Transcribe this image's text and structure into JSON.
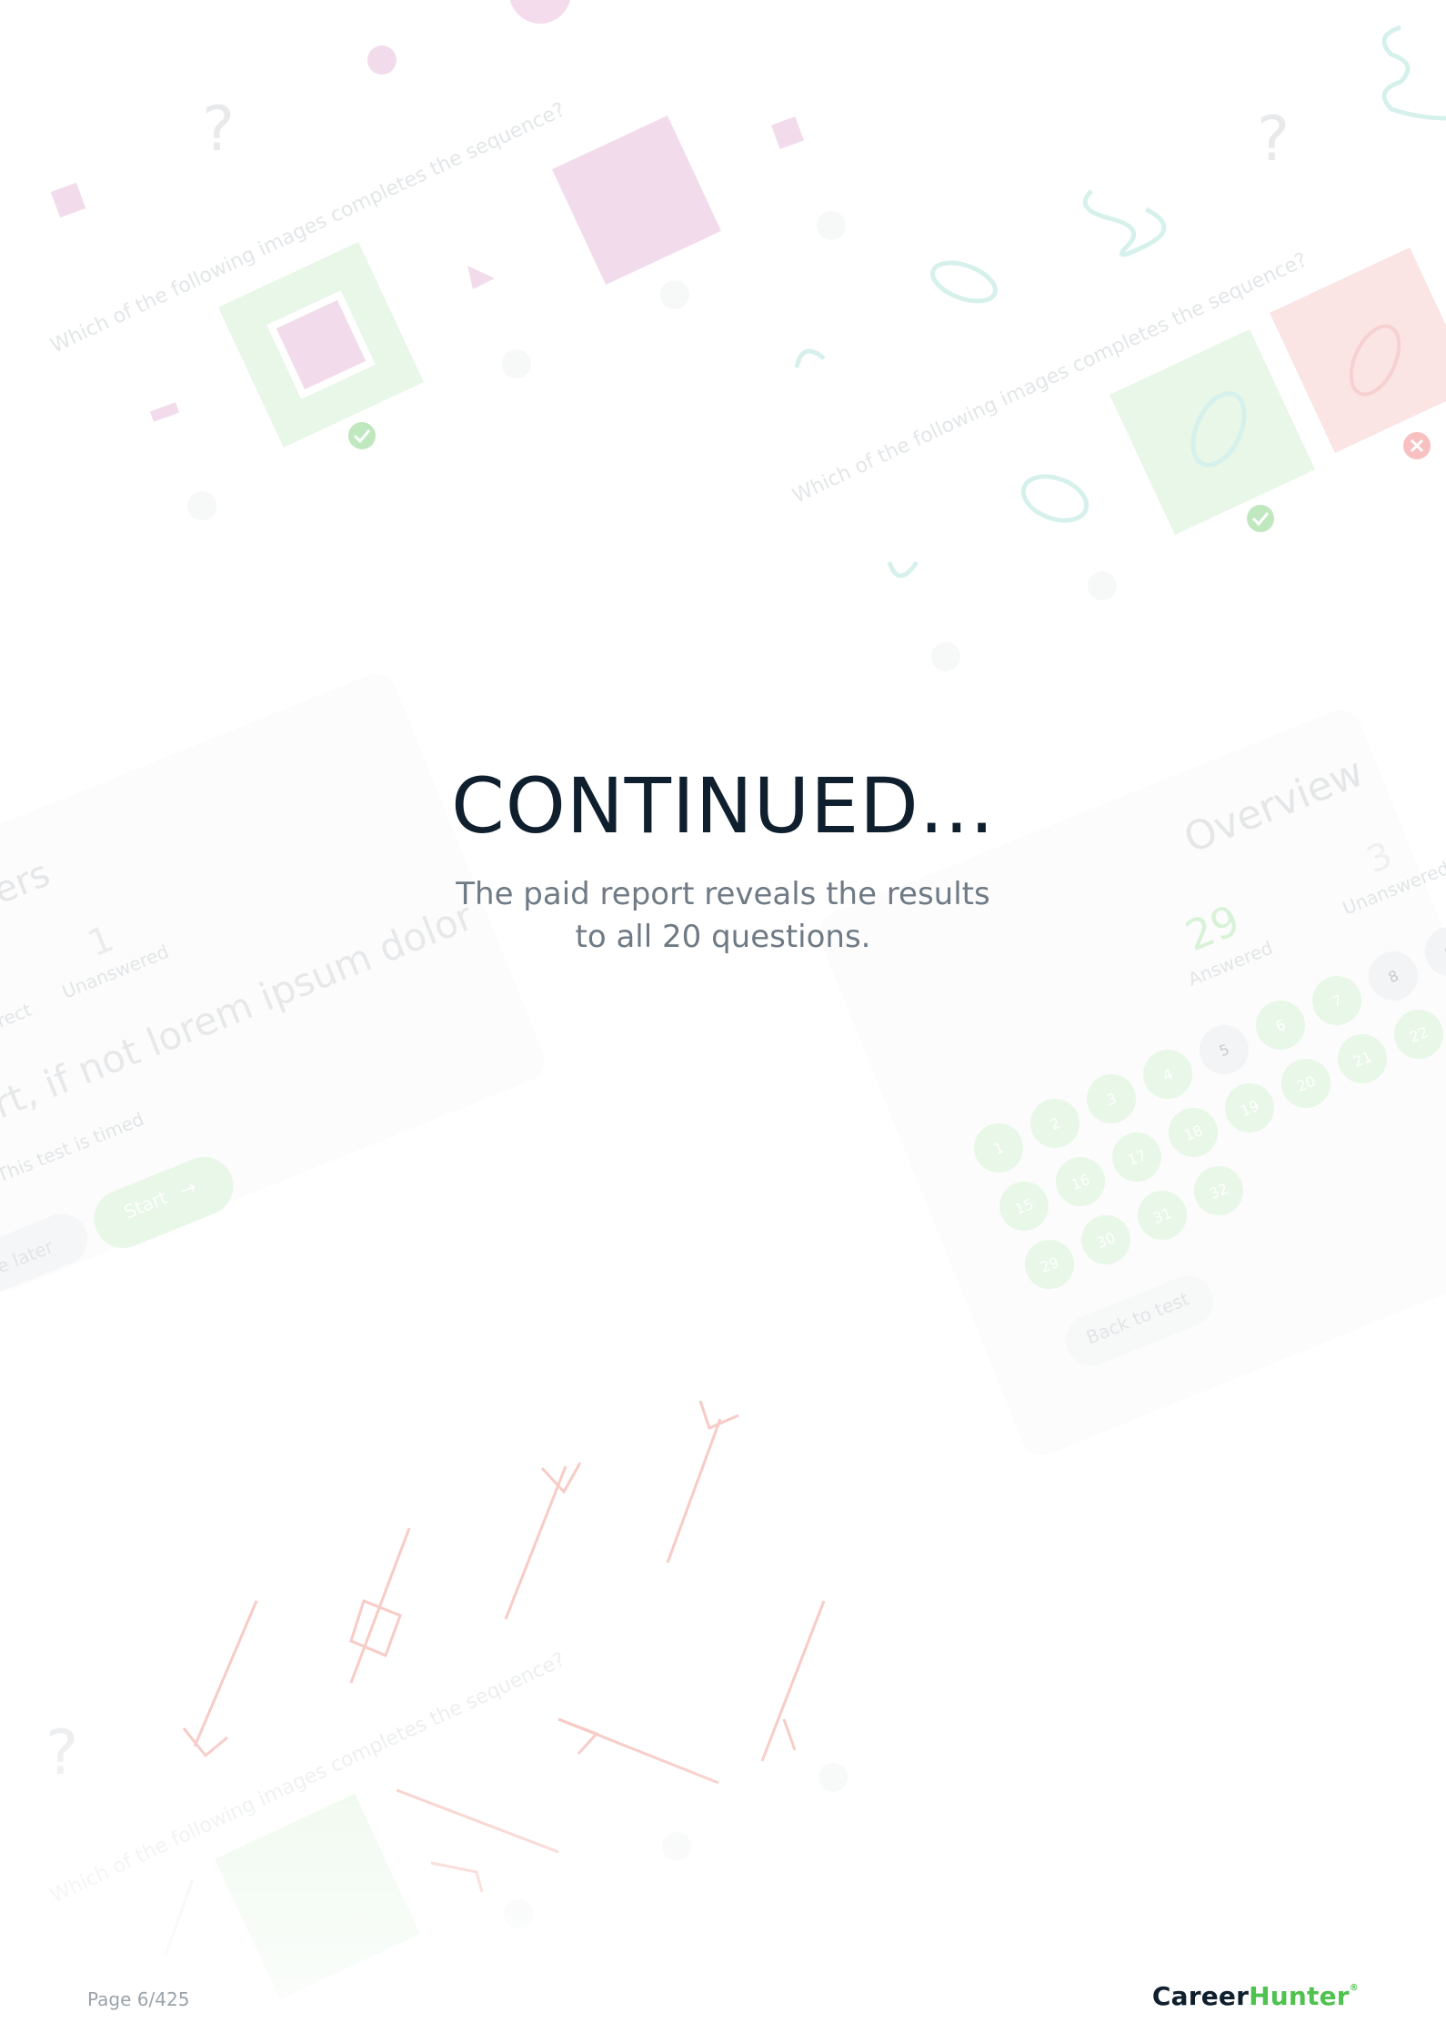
{
  "hero": {
    "title": "CONTINUED...",
    "subtitle": "The paid report reveals the results to all 20 questions."
  },
  "footer": {
    "page": "Page 6/425",
    "brand_part1": "Career",
    "brand_part2": "Hunter",
    "brand_mark": "®"
  },
  "background": {
    "question_prompt": "Which of the following images completes the sequence?",
    "question_mark": "?",
    "left_card": {
      "heading": "ers",
      "unanswered_count": "1",
      "unanswered_label": "Unanswered",
      "correct_label": "rect",
      "statement": "rt, if not lorem ipsum dolor",
      "timed_note": "This test is timed",
      "later_label": "e later",
      "start_label": "Start",
      "start_arrow": "→"
    },
    "overview_card": {
      "title": "Overview",
      "answered_count": "29",
      "answered_label": "Answered",
      "unanswered_count": "3",
      "unanswered_label": "Unanswered",
      "back_label": "Back to test",
      "bubbles": [
        "1",
        "2",
        "3",
        "4",
        "5",
        "6",
        "7",
        "8",
        "9",
        "15",
        "16",
        "17",
        "18",
        "19",
        "20",
        "21",
        "22",
        "29",
        "30",
        "31",
        "32"
      ]
    }
  },
  "colors": {
    "title": "#0f1f2e",
    "subtitle": "#6f7a84",
    "brand_green": "#4fc24f",
    "pink": "#f2dcec",
    "green_tint": "#e6f6e6",
    "red_tint": "#fbe4e4",
    "teal": "#cfeee8",
    "salmon": "#f7c5bf"
  }
}
